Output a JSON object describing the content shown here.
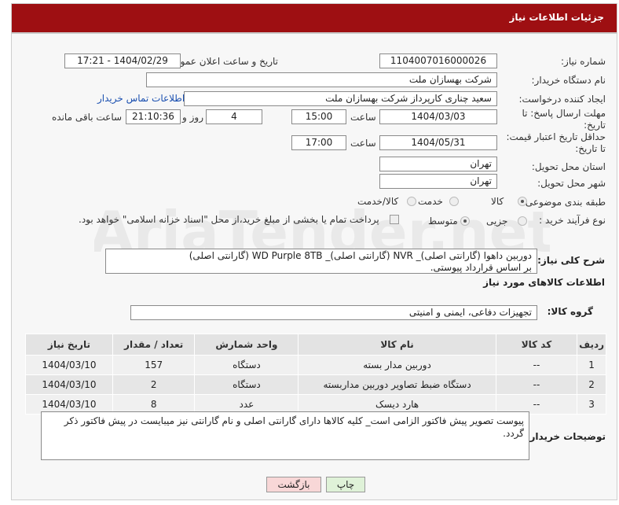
{
  "header": {
    "title": "جزئیات اطلاعات نیاز"
  },
  "fields": {
    "need_number_label": "شماره نیاز:",
    "need_number": "1104007016000026",
    "announce_label": "تاریخ و ساعت اعلان عمومی:",
    "announce_value": "1404/02/29 - 17:21",
    "buyer_org_label": "نام دستگاه خریدار:",
    "buyer_org": "شرکت بهسازان ملت",
    "creator_label": "ایجاد کننده درخواست:",
    "creator": "سعید چناری کارپرداز شرکت بهسازان ملت",
    "contact_link": "اطلاعات تماس خریدار",
    "send_deadline_label_1": "مهلت ارسال پاسخ: تا",
    "send_deadline_label_2": "تاریخ:",
    "send_date": "1404/03/03",
    "time_label": "ساعت",
    "send_time": "15:00",
    "days_value": "4",
    "days_label": "روز و",
    "remaining_time": "21:10:36",
    "remaining_label": "ساعت باقی مانده",
    "price_validity_label_1": "حداقل تاریخ اعتبار قیمت:",
    "price_validity_label_2": "تا تاریخ:",
    "price_date": "1404/05/31",
    "price_time": "17:00",
    "province_label": "استان محل تحویل:",
    "province": "تهران",
    "city_label": "شهر محل تحویل:",
    "city": "تهران",
    "category_label": "طبقه بندی موضوعی:",
    "category_options": [
      "کالا",
      "خدمت",
      "کالا/خدمت"
    ],
    "process_label": "نوع فرآیند خرید :",
    "process_options": [
      "جزیی",
      "متوسط"
    ],
    "payment_note": "پرداخت تمام یا بخشی از مبلغ خرید،از محل \"اسناد خزانه اسلامی\" خواهد بود."
  },
  "description": {
    "label": "شرح کلی نیاز:",
    "line1": "دوربین داهوا (گارانتی اصلی)_ NVR (گارانتی اصلی)_ WD Purple 8TB (گارانتی اصلی)",
    "line2": "بر اساس قرارداد پیوستی."
  },
  "goods": {
    "section_title": "اطلاعات کالاهای مورد نیاز",
    "group_label": "گروه کالا:",
    "group_value": "تجهیزات دفاعی، ایمنی و امنیتی",
    "columns": [
      "ردیف",
      "کد کالا",
      "نام کالا",
      "واحد شمارش",
      "تعداد / مقدار",
      "تاریخ نیاز"
    ],
    "rows": [
      {
        "row": "1",
        "code": "--",
        "name": "دوربین مدار بسته",
        "unit": "دستگاه",
        "qty": "157",
        "date": "1404/03/10"
      },
      {
        "row": "2",
        "code": "--",
        "name": "دستگاه ضبط تصاویر دوربین مداربسته",
        "unit": "دستگاه",
        "qty": "2",
        "date": "1404/03/10"
      },
      {
        "row": "3",
        "code": "--",
        "name": "هارد دیسک",
        "unit": "عدد",
        "qty": "8",
        "date": "1404/03/10"
      }
    ]
  },
  "buyer_notes": {
    "label": "توضیحات خریدار:",
    "text": "پیوست تصویر پیش فاکتور الزامی است_ کلیه کالاها  دارای گارانتی اصلی و نام گارانتی نیز میبایست در پیش فاکتور ذکر گردد."
  },
  "buttons": {
    "print": "چاپ",
    "back": "بازگشت"
  },
  "watermark": {
    "text": "AriaTender.net"
  },
  "colors": {
    "header_bg": "#9e0f12",
    "link": "#1a4fb0",
    "back_button_bg": "#f8d7d7",
    "print_button_bg": "#dff2d8"
  }
}
